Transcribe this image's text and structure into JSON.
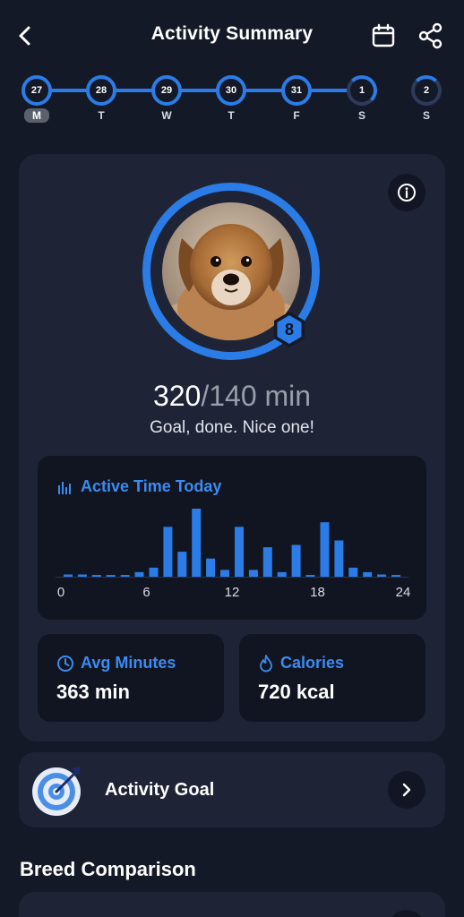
{
  "header": {
    "title": "Activity Summary",
    "back_icon": "chevron-left-icon",
    "calendar_icon": "calendar-icon",
    "share_icon": "share-icon"
  },
  "week": {
    "days": [
      {
        "date": "27",
        "label": "M",
        "selected": true
      },
      {
        "date": "28",
        "label": "T",
        "selected": false
      },
      {
        "date": "29",
        "label": "W",
        "selected": false
      },
      {
        "date": "30",
        "label": "T",
        "selected": false
      },
      {
        "date": "31",
        "label": "F",
        "selected": false
      },
      {
        "date": "1",
        "label": "S",
        "selected": false
      },
      {
        "date": "2",
        "label": "S",
        "selected": false
      }
    ]
  },
  "summary": {
    "level": "8",
    "current_minutes": "320",
    "goal_minutes": "/140 min",
    "message": "Goal, done. Nice one!"
  },
  "active_time": {
    "title": "Active Time Today",
    "x_ticks": [
      "0",
      "6",
      "12",
      "18",
      "24"
    ]
  },
  "chart_data": {
    "type": "bar",
    "title": "Active Time Today",
    "x": [
      0,
      1,
      2,
      3,
      4,
      5,
      6,
      7,
      8,
      9,
      10,
      11,
      12,
      13,
      14,
      15,
      16,
      17,
      18,
      19,
      20,
      21,
      22,
      23
    ],
    "values": [
      1,
      1,
      0.5,
      0.5,
      0.5,
      2,
      4,
      22,
      11,
      30,
      8,
      3,
      22,
      3,
      13,
      2,
      14,
      0.5,
      24,
      16,
      4,
      2,
      1,
      0.5
    ],
    "xlim": [
      0,
      24
    ]
  },
  "stats": {
    "avg_title": "Avg Minutes",
    "avg_value": "363 min",
    "calories_title": "Calories",
    "calories_value": "720 kcal"
  },
  "goal": {
    "label": "Activity Goal"
  },
  "breed": {
    "heading": "Breed Comparison"
  },
  "colors": {
    "accent": "#2b7ce6",
    "background": "#141927",
    "card": "#1e2436",
    "inner_card": "#111522"
  }
}
